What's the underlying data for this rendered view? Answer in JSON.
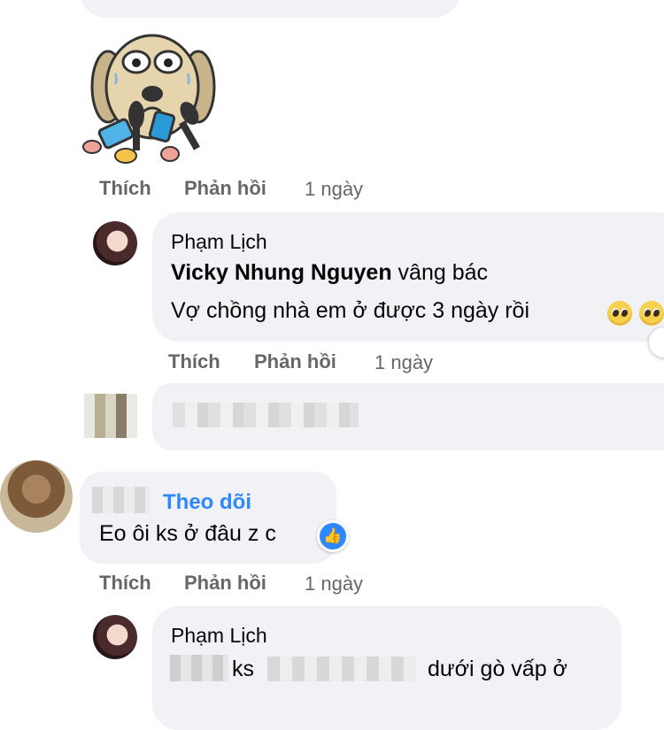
{
  "comments": [
    {
      "sticker": "reporter-dog-sticker",
      "actions": {
        "like": "Thích",
        "reply": "Phản hồi",
        "time": "1 ngày"
      }
    },
    {
      "author": "Phạm Lịch",
      "mention": "Vicky Nhung Nguyen",
      "line1_rest": " vâng bác",
      "line2": "Vợ chồng nhà em ở được 3 ngày rồi",
      "actions": {
        "like": "Thích",
        "reply": "Phản hồi",
        "time": "1 ngày"
      }
    },
    {
      "author_hidden": true
    },
    {
      "follow": "Theo dõi",
      "text": "Eo ôi ks ở đâu z c",
      "reaction": "like-icon",
      "actions": {
        "like": "Thích",
        "reply": "Phản hồi",
        "time": "1 ngày"
      }
    },
    {
      "author": "Phạm Lịch",
      "text_part1": "ks",
      "text_part2": "dưới gò vấp ở"
    }
  ],
  "colors": {
    "bubble": "#f0f2f5",
    "meta": "#65676b",
    "link": "#2d88ff"
  }
}
